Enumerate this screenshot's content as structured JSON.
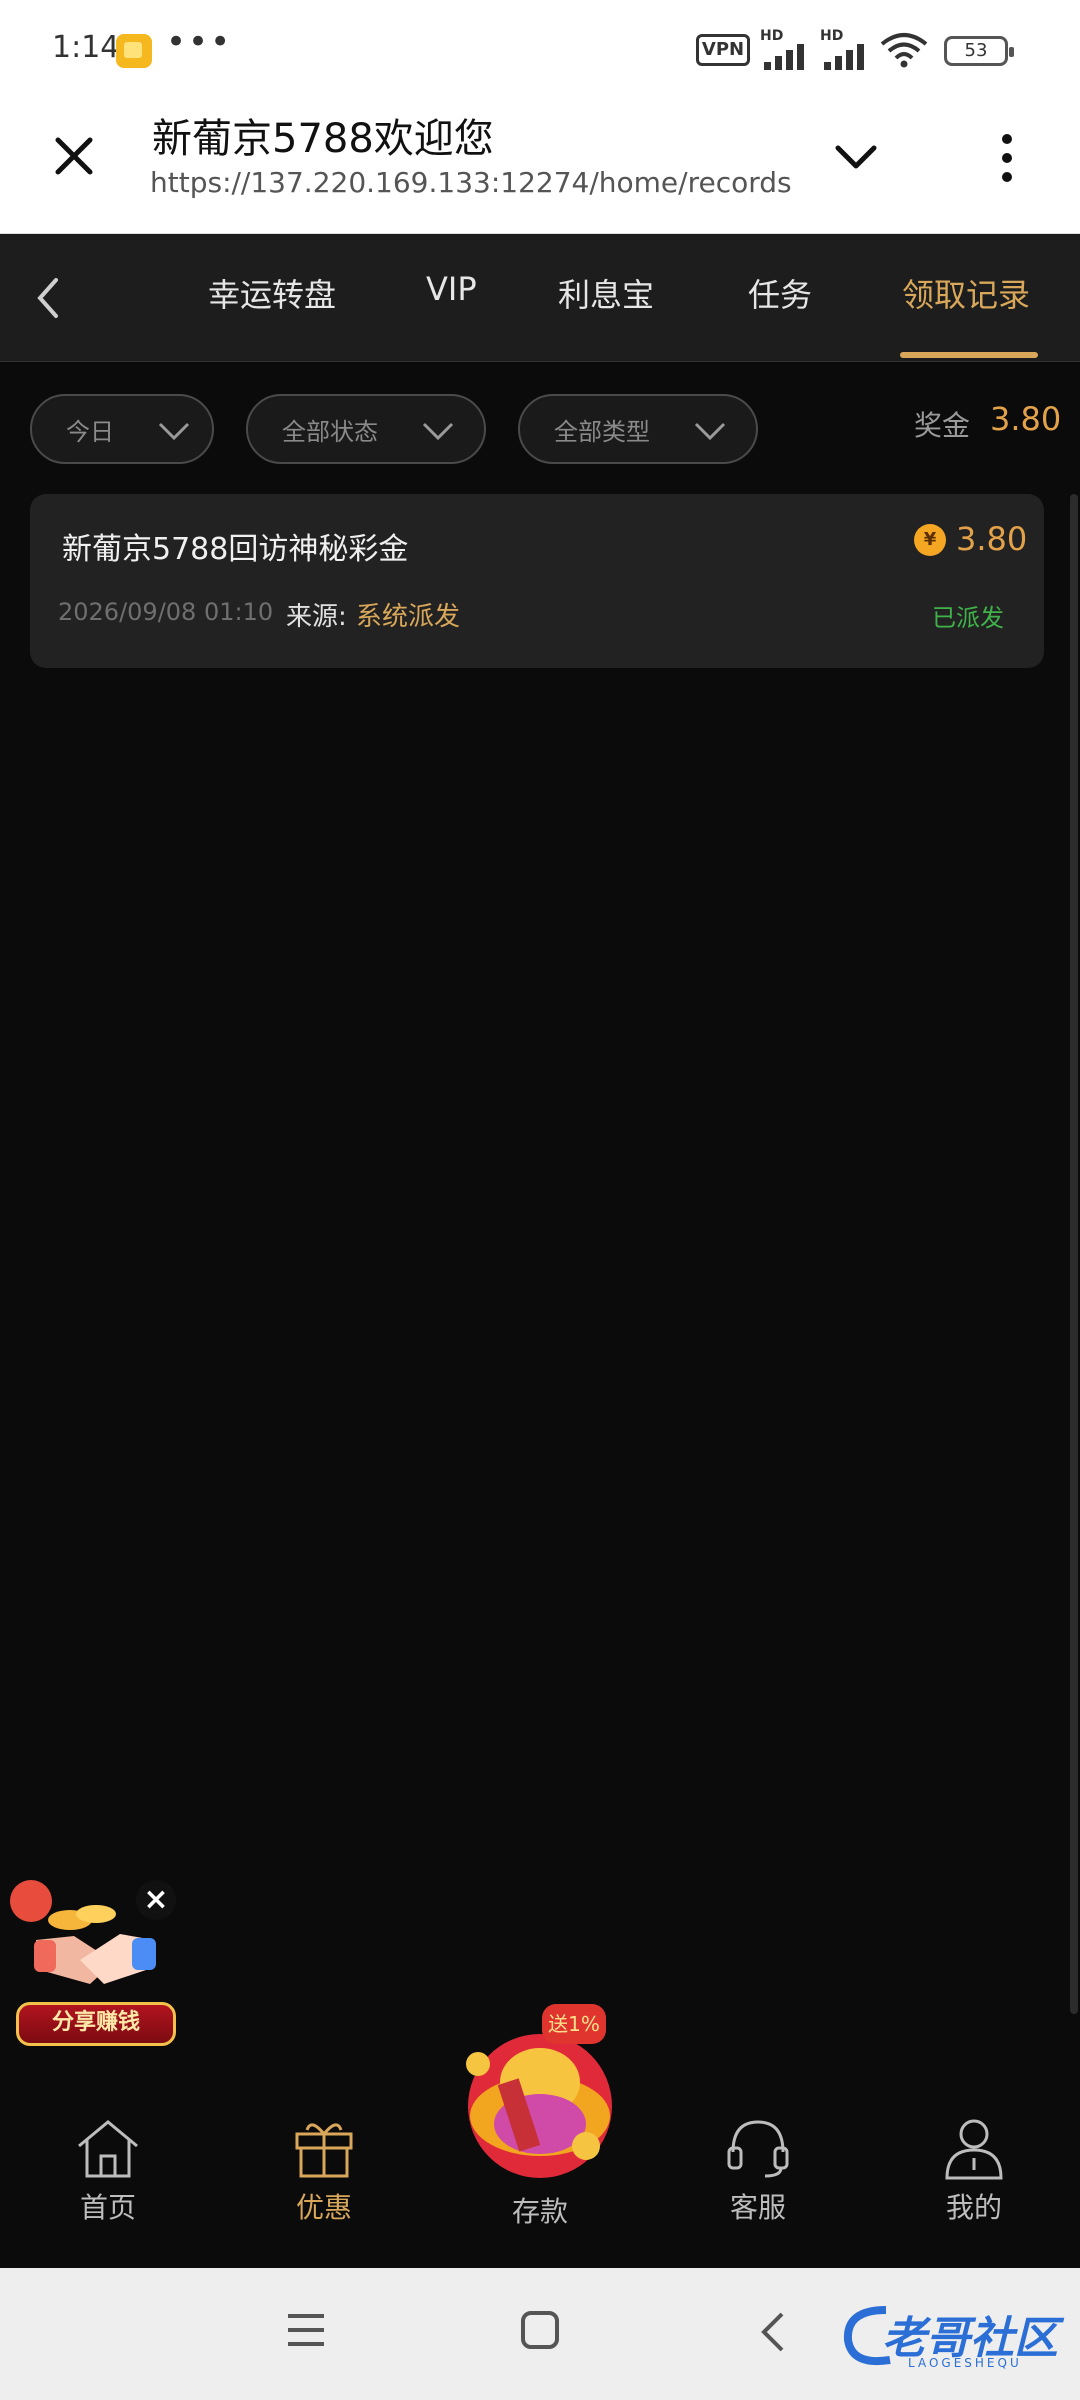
{
  "status_bar": {
    "time": "1:14",
    "dots": "•••",
    "vpn": "VPN",
    "sim1": "HD",
    "sim2": "HD",
    "battery": "53"
  },
  "browser": {
    "title": "新葡京5788欢迎您",
    "url": "https://137.220.169.133:12274/home/records"
  },
  "tabs": [
    {
      "label": "幸运转盘"
    },
    {
      "label": "VIP"
    },
    {
      "label": "利息宝"
    },
    {
      "label": "任务"
    },
    {
      "label": "领取记录"
    }
  ],
  "filters": {
    "date": "今日",
    "status": "全部状态",
    "type": "全部类型"
  },
  "bonus": {
    "label": "奖金",
    "value": "3.80"
  },
  "records": [
    {
      "title": "新葡京5788回访神秘彩金",
      "coin_symbol": "¥",
      "amount": "3.80",
      "time": "2026/09/08  01:10",
      "source_label": "来源:",
      "source_value": "系统派发",
      "status": "已派发"
    }
  ],
  "float_share": {
    "close": "×",
    "banner": "分享赚钱"
  },
  "bottom_nav": {
    "home": "首页",
    "promo": "优惠",
    "deposit": "存款",
    "deposit_badge": "送1%",
    "service": "客服",
    "mine": "我的"
  },
  "watermark": {
    "text": "老哥社区",
    "sub": "LAOGESHEQU"
  },
  "colors": {
    "accent": "#d8a75a",
    "amount": "#e3a24a",
    "success": "#3fb24a",
    "background": "#0b0b0b"
  }
}
